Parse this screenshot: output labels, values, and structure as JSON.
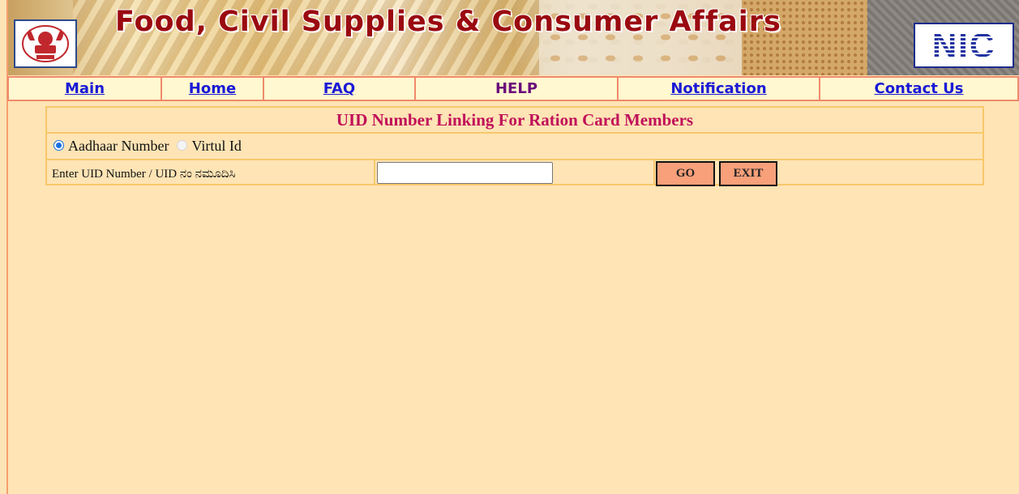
{
  "banner": {
    "title": "Food, Civil Supplies & Consumer Affairs",
    "right_logo_text": "NIC",
    "left_logo_icon": "state-emblem-icon"
  },
  "nav": {
    "items": [
      {
        "label": "Main"
      },
      {
        "label": "Home"
      },
      {
        "label": "FAQ"
      },
      {
        "label": "HELP"
      },
      {
        "label": "Notification"
      },
      {
        "label": "Contact Us"
      }
    ]
  },
  "form": {
    "title": "UID Number Linking For Ration Card Members",
    "radio_options": [
      {
        "label": "Aadhaar Number",
        "checked": true
      },
      {
        "label": "Virtul Id",
        "checked": false
      }
    ],
    "input_label": "Enter UID Number  / UID ನಂ ನಮೂದಿಸಿ",
    "input_value": "",
    "go_label": "GO",
    "exit_label": "EXIT"
  },
  "colors": {
    "page_background": "#ffe4b5",
    "banner_title": "#9a0a10",
    "nav_link": "#1a1ad6",
    "nav_help": "#6a0a7a",
    "form_title": "#c0105a",
    "button_background": "#f7a07a",
    "table_border": "#f7c86a"
  }
}
